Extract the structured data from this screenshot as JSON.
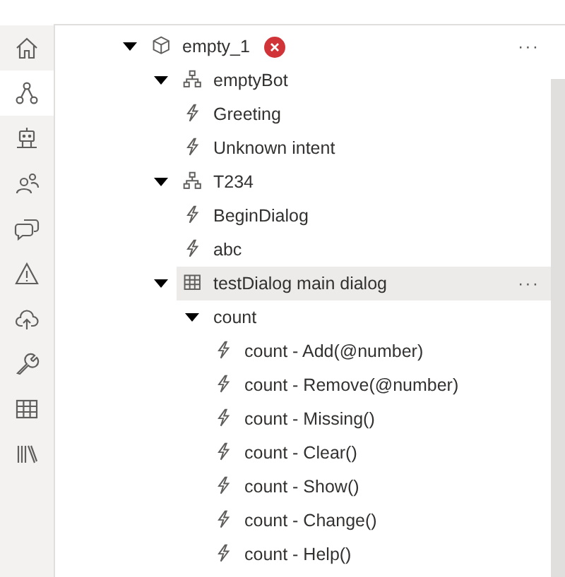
{
  "nav": [
    {
      "kind": "home",
      "selected": false
    },
    {
      "kind": "flow",
      "selected": true
    },
    {
      "kind": "robot",
      "selected": false
    },
    {
      "kind": "users",
      "selected": false
    },
    {
      "kind": "chat",
      "selected": false
    },
    {
      "kind": "warning",
      "selected": false
    },
    {
      "kind": "upload",
      "selected": false
    },
    {
      "kind": "wrench",
      "selected": false
    },
    {
      "kind": "table",
      "selected": false
    },
    {
      "kind": "library",
      "selected": false
    }
  ],
  "tree": [
    {
      "label": "empty_1",
      "kind": "bot",
      "error": true,
      "menu": "···",
      "selected": false,
      "expanded": true,
      "children": [
        {
          "label": "emptyBot",
          "kind": "dialog",
          "selected": false,
          "expanded": true,
          "children": [
            {
              "label": "Greeting",
              "kind": "trigger",
              "selected": false
            },
            {
              "label": "Unknown intent",
              "kind": "trigger",
              "selected": false
            }
          ]
        },
        {
          "label": "T234",
          "kind": "dialog",
          "selected": false,
          "expanded": true,
          "children": [
            {
              "label": "BeginDialog",
              "kind": "trigger",
              "selected": false
            },
            {
              "label": "abc",
              "kind": "trigger",
              "selected": false
            }
          ]
        },
        {
          "label": "testDialog main dialog",
          "kind": "main",
          "menu": "···",
          "selected": true,
          "expanded": true,
          "children": [
            {
              "label": "count",
              "kind": "group",
              "selected": false,
              "expanded": true,
              "children": [
                {
                  "label": "count - Add(@number)",
                  "kind": "trigger",
                  "selected": false
                },
                {
                  "label": "count - Remove(@number)",
                  "kind": "trigger",
                  "selected": false
                },
                {
                  "label": "count - Missing()",
                  "kind": "trigger",
                  "selected": false
                },
                {
                  "label": "count - Clear()",
                  "kind": "trigger",
                  "selected": false
                },
                {
                  "label": "count - Show()",
                  "kind": "trigger",
                  "selected": false
                },
                {
                  "label": "count - Change()",
                  "kind": "trigger",
                  "selected": false
                },
                {
                  "label": "count - Help()",
                  "kind": "trigger",
                  "selected": false
                }
              ]
            }
          ]
        }
      ]
    }
  ]
}
